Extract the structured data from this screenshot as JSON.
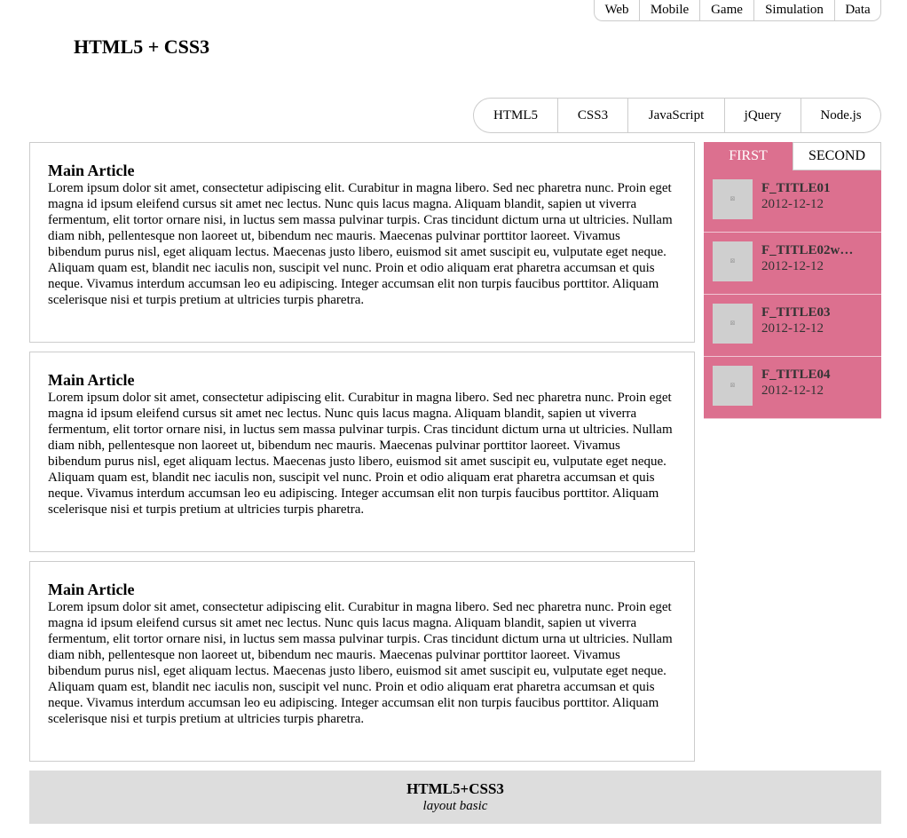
{
  "top_nav": [
    "Web",
    "Mobile",
    "Game",
    "Simulation",
    "Data"
  ],
  "site_title": "HTML5 + CSS3",
  "main_nav": [
    "HTML5",
    "CSS3",
    "JavaScript",
    "jQuery",
    "Node.js"
  ],
  "articles": [
    {
      "heading": "Main Article",
      "body": "Lorem ipsum dolor sit amet, consectetur adipiscing elit. Curabitur in magna libero. Sed nec pharetra nunc. Proin eget magna id ipsum eleifend cursus sit amet nec lectus. Nunc quis lacus magna. Aliquam blandit, sapien ut viverra fermentum, elit tortor ornare nisi, in luctus sem massa pulvinar turpis. Cras tincidunt dictum urna ut ultricies. Nullam diam nibh, pellentesque non laoreet ut, bibendum nec mauris. Maecenas pulvinar porttitor laoreet. Vivamus bibendum purus nisl, eget aliquam lectus. Maecenas justo libero, euismod sit amet suscipit eu, vulputate eget neque. Aliquam quam est, blandit nec iaculis non, suscipit vel nunc. Proin et odio aliquam erat pharetra accumsan et quis neque. Vivamus interdum accumsan leo eu adipiscing. Integer accumsan elit non turpis faucibus porttitor. Aliquam scelerisque nisi et turpis pretium at ultricies turpis pharetra."
    },
    {
      "heading": "Main Article",
      "body": "Lorem ipsum dolor sit amet, consectetur adipiscing elit. Curabitur in magna libero. Sed nec pharetra nunc. Proin eget magna id ipsum eleifend cursus sit amet nec lectus. Nunc quis lacus magna. Aliquam blandit, sapien ut viverra fermentum, elit tortor ornare nisi, in luctus sem massa pulvinar turpis. Cras tincidunt dictum urna ut ultricies. Nullam diam nibh, pellentesque non laoreet ut, bibendum nec mauris. Maecenas pulvinar porttitor laoreet. Vivamus bibendum purus nisl, eget aliquam lectus. Maecenas justo libero, euismod sit amet suscipit eu, vulputate eget neque. Aliquam quam est, blandit nec iaculis non, suscipit vel nunc. Proin et odio aliquam erat pharetra accumsan et quis neque. Vivamus interdum accumsan leo eu adipiscing. Integer accumsan elit non turpis faucibus porttitor. Aliquam scelerisque nisi et turpis pretium at ultricies turpis pharetra."
    },
    {
      "heading": "Main Article",
      "body": "Lorem ipsum dolor sit amet, consectetur adipiscing elit. Curabitur in magna libero. Sed nec pharetra nunc. Proin eget magna id ipsum eleifend cursus sit amet nec lectus. Nunc quis lacus magna. Aliquam blandit, sapien ut viverra fermentum, elit tortor ornare nisi, in luctus sem massa pulvinar turpis. Cras tincidunt dictum urna ut ultricies. Nullam diam nibh, pellentesque non laoreet ut, bibendum nec mauris. Maecenas pulvinar porttitor laoreet. Vivamus bibendum purus nisl, eget aliquam lectus. Maecenas justo libero, euismod sit amet suscipit eu, vulputate eget neque. Aliquam quam est, blandit nec iaculis non, suscipit vel nunc. Proin et odio aliquam erat pharetra accumsan et quis neque. Vivamus interdum accumsan leo eu adipiscing. Integer accumsan elit non turpis faucibus porttitor. Aliquam scelerisque nisi et turpis pretium at ultricies turpis pharetra."
    }
  ],
  "aside": {
    "tabs": [
      "FIRST",
      "SECOND"
    ],
    "items": [
      {
        "title": "F_TITLE01",
        "date": "2012-12-12"
      },
      {
        "title": "F_TITLE02w…",
        "date": "2012-12-12"
      },
      {
        "title": "F_TITLE03",
        "date": "2012-12-12"
      },
      {
        "title": "F_TITLE04",
        "date": "2012-12-12"
      }
    ]
  },
  "footer": {
    "title": "HTML5+CSS3",
    "subtitle": "layout basic"
  },
  "colors": {
    "accent": "#dc708f",
    "border": "#cccccc",
    "footer_bg": "#dddddd"
  }
}
